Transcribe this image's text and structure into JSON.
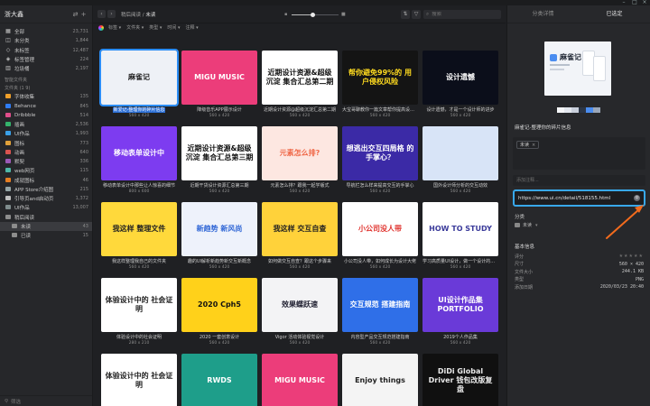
{
  "sidebar": {
    "library_name": "浙大鑫",
    "nav": [
      {
        "label": "全部",
        "count": "23,731",
        "icon": "all-icon",
        "color": "#c8c8c8"
      },
      {
        "label": "未分类",
        "count": "1,844",
        "icon": "unsorted-icon",
        "color": "#c8c8c8"
      },
      {
        "label": "未标签",
        "count": "12,487",
        "icon": "untagged-icon",
        "color": "#c8c8c8"
      },
      {
        "label": "标签管理",
        "count": "224",
        "icon": "tag-icon",
        "color": "#c8c8c8"
      },
      {
        "label": "垃圾桶",
        "count": "2,197",
        "icon": "trash-icon",
        "color": "#c8c8c8"
      }
    ],
    "smart_folders_title": "智能文件夹",
    "folders_title": "文件夹 (1 9)",
    "folders": [
      {
        "label": "字体收集",
        "count": "135",
        "color": "#f0a02a"
      },
      {
        "label": "Behance",
        "count": "845",
        "color": "#2f7df6"
      },
      {
        "label": "Dribbble",
        "count": "514",
        "color": "#e04e8b"
      },
      {
        "label": "插画",
        "count": "2,536",
        "color": "#34b36b"
      },
      {
        "label": "UI作品",
        "count": "1,993",
        "color": "#3aa0e8"
      },
      {
        "label": "图标",
        "count": "773",
        "color": "#e0a13a"
      },
      {
        "label": "动画",
        "count": "640",
        "color": "#d9534f"
      },
      {
        "label": "默契",
        "count": "336",
        "color": "#9b59b6"
      },
      {
        "label": "web网页",
        "count": "115",
        "color": "#4fb8a8"
      },
      {
        "label": "成就图标",
        "count": "46",
        "color": "#e67e22"
      },
      {
        "label": "APP Store介绍图",
        "count": "215",
        "color": "#95a5a6"
      },
      {
        "label": "引导页and启动页",
        "count": "1,372",
        "color": "#c0c0c0"
      },
      {
        "label": "UI作品",
        "count": "13,007",
        "color": "#7f8c8d"
      },
      {
        "label": "稍后阅读",
        "count": "",
        "color": "#8d8d8d"
      },
      {
        "label": "未读",
        "count": "43",
        "color": "#8d8d8d",
        "active": true,
        "sub": true
      },
      {
        "label": "已读",
        "count": "15",
        "color": "#8d8d8d",
        "sub": true
      }
    ],
    "filter_placeholder": "筛选"
  },
  "toolbar": {
    "crumb_parent": "稍后阅读",
    "crumb_sep": "/",
    "crumb_current": "未读",
    "zoom_value": 0.45,
    "search_placeholder": "搜索",
    "icons": [
      "sort-icon",
      "filter-icon",
      "search-icon"
    ]
  },
  "filterbar": [
    "标签",
    "文件夹",
    "类型",
    "时间",
    "注释"
  ],
  "cards": [
    {
      "title": "新爱记-整理你的碎片信息",
      "size": "560 x 420",
      "bg": "#eef1f6",
      "fg": "#222",
      "headline": "麻雀记",
      "selected": true
    },
    {
      "title": "降级音乐APP展示设计",
      "size": "560 x 420",
      "bg": "#ec3d7a",
      "fg": "#fff",
      "headline": "MIGU MUSIC"
    },
    {
      "title": "近期设计资源@超级沉淀汇总第二期",
      "size": "560 x 420",
      "bg": "#ffffff",
      "fg": "#111",
      "headline": "近期设计资源&超级沉淀 集合汇总第二期"
    },
    {
      "title": "大宝哥聊教你一篇文章帮你提高设计效率",
      "size": "560 x 420",
      "bg": "#141414",
      "fg": "#ffdb1f",
      "headline": "帮你避免99%的 用户侵权风险"
    },
    {
      "title": "设计遗憾，才是一个设计师的进步",
      "size": "560 x 420",
      "bg": "#0b0e1a",
      "fg": "#fff",
      "headline": "设计遗憾"
    },
    {
      "title": "移动表单设计中那些让人惊喜的细节",
      "size": "800 x 600",
      "bg": "#7d3cf0",
      "fg": "#fff",
      "headline": "移动表单设计中"
    },
    {
      "title": "近期干货设计资源汇总第三期",
      "size": "560 x 420",
      "bg": "#ffffff",
      "fg": "#111",
      "headline": "近期设计资源&超级沉淀 集合汇总第三期"
    },
    {
      "title": "元素怎么排？跟我一起学版式",
      "size": "560 x 420",
      "bg": "#fde7e1",
      "fg": "#f06a4a",
      "headline": "元素怎么排?"
    },
    {
      "title": "导航栏怎么样来提高交互的手掌心",
      "size": "560 x 420",
      "bg": "#3b2aa6",
      "fg": "#fff",
      "headline": "想逃出交互四局格 的手掌心？"
    },
    {
      "title": "国外设计师分析的交互动效",
      "size": "560 x 420",
      "bg": "#d8e4f7",
      "fg": "#223",
      "headline": ""
    },
    {
      "title": "我这样整理我自己的文件夹",
      "size": "560 x 420",
      "bg": "#ffd93b",
      "fg": "#222",
      "headline": "我这样 整理文件"
    },
    {
      "title": "趣的UI解析新趋势新交互新概念",
      "size": "560 x 420",
      "bg": "#eef2fb",
      "fg": "#2f66d6",
      "headline": "新趋势 新风尚"
    },
    {
      "title": "如何做交互自查？跟这个步骤来",
      "size": "560 x 420",
      "bg": "#ffd23a",
      "fg": "#222",
      "headline": "我这样 交互自查"
    },
    {
      "title": "小公司没人带，如何成长为设计大佬",
      "size": "560 x 420",
      "bg": "#ffffff",
      "fg": "#e0332e",
      "headline": "小公司没人带"
    },
    {
      "title": "学习高质量UI设计，做一个设计的初学者",
      "size": "560 x 420",
      "bg": "#ffffff",
      "fg": "#3a3a9a",
      "headline": "HOW TO STUDY"
    },
    {
      "title": "体验设计中的社会证明",
      "size": "280 x 210",
      "bg": "#ffffff",
      "fg": "#222",
      "headline": "体验设计中的 社会证明"
    },
    {
      "title": "2020 一套创意设计",
      "size": "560 x 420",
      "bg": "#ffd11a",
      "fg": "#111",
      "headline": "2020 Cph5"
    },
    {
      "title": "Vigor 活动体验视觉设计",
      "size": "560 x 420",
      "bg": "#f3f3f5",
      "fg": "#223",
      "headline": "效果蝶跃速"
    },
    {
      "title": "内容型产品交互规范搭建指南",
      "size": "560 x 420",
      "bg": "#2f6fe8",
      "fg": "#fff",
      "headline": "交互规范 搭建指南"
    },
    {
      "title": "2019个人作品集",
      "size": "560 x 420",
      "bg": "#6a3ad8",
      "fg": "#fff",
      "headline": "UI设计作品集 PORTFOLIO"
    },
    {
      "title": "体验设计中的社会证明",
      "size": "",
      "bg": "#ffffff",
      "fg": "#222",
      "headline": "体验设计中的 社会证明"
    },
    {
      "title": "RWDS",
      "size": "",
      "bg": "#1e9e8a",
      "fg": "#fff",
      "headline": "RWDS"
    },
    {
      "title": "MIGU MUSIC",
      "size": "",
      "bg": "#ec3d7a",
      "fg": "#fff",
      "headline": "MIGU MUSIC"
    },
    {
      "title": "Enjoy things",
      "size": "",
      "bg": "#f4f4f4",
      "fg": "#222",
      "headline": "Enjoy things"
    },
    {
      "title": "DiDi Global Driver",
      "size": "",
      "bg": "#101010",
      "fg": "#eaeaea",
      "headline": "DiDi Global Driver 钱包改版复盘"
    }
  ],
  "inspector": {
    "tabs": [
      "分类详情",
      "已选定"
    ],
    "preview_headline": "麻雀记",
    "palette": [
      "#f5f6f8",
      "#e3e7ee",
      "#c9cfdb",
      "#2c3646",
      "#4b8df0",
      "#9aa6b8"
    ],
    "title": "麻雀记-整理你的碎片信息",
    "tag": "未读",
    "notes_placeholder": "添加注释...",
    "url": "https://www.ui.cn/detail/518155.html",
    "category_title": "分类",
    "category_value": "未读",
    "basic_title": "基本信息",
    "info": [
      {
        "k": "评分",
        "v": "★★★★★",
        "stars": true
      },
      {
        "k": "尺寸",
        "v": "560 × 420"
      },
      {
        "k": "文件大小",
        "v": "244.1 KB"
      },
      {
        "k": "类型",
        "v": "PNG"
      },
      {
        "k": "添加日期",
        "v": "2020/03/23 20:40"
      }
    ]
  },
  "colors": {
    "accent": "#2b8df5",
    "url_highlight": "#38a8ea",
    "arrow": "#f26b1d"
  }
}
